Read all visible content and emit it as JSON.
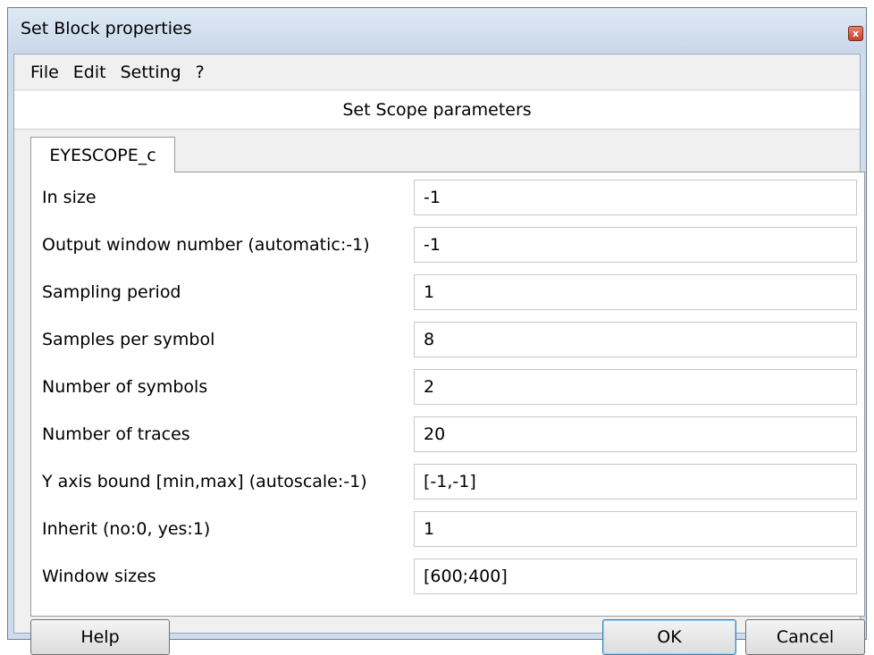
{
  "window": {
    "title": "Set Block properties",
    "close_glyph": "x"
  },
  "menu": [
    "File",
    "Edit",
    "Setting",
    "?"
  ],
  "header": {
    "title": "Set Scope parameters"
  },
  "tab": {
    "label": "EYESCOPE_c"
  },
  "fields": [
    {
      "label": "In size",
      "value": "-1"
    },
    {
      "label": "Output window number (automatic:-1)",
      "value": "-1"
    },
    {
      "label": "Sampling period",
      "value": "1"
    },
    {
      "label": "Samples per symbol",
      "value": "8"
    },
    {
      "label": "Number of symbols",
      "value": "2"
    },
    {
      "label": "Number of traces",
      "value": "20"
    },
    {
      "label": "Y axis bound [min,max] (autoscale:-1)",
      "value": "[-1,-1]"
    },
    {
      "label": "Inherit (no:0, yes:1)",
      "value": "1"
    },
    {
      "label": "Window sizes",
      "value": "[600;400]"
    }
  ],
  "buttons": {
    "help": "Help",
    "ok": "OK",
    "cancel": "Cancel"
  }
}
